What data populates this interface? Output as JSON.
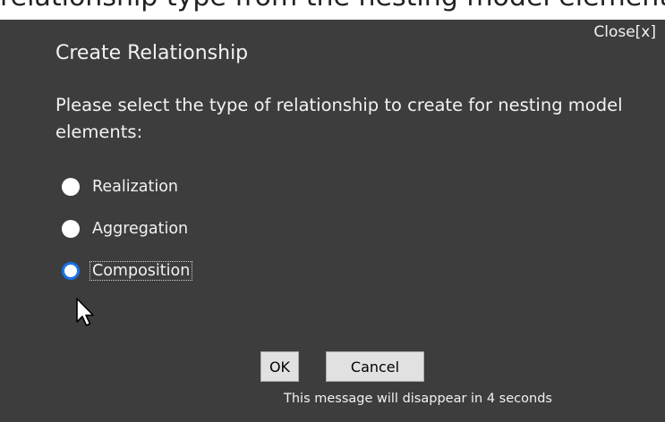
{
  "dialog": {
    "close_label": "Close[x]",
    "title": "Create Relationship",
    "message": "Please select the type of relationship to create for nesting model elements:",
    "options": [
      {
        "label": "Realization",
        "selected": false
      },
      {
        "label": "Aggregation",
        "selected": false
      },
      {
        "label": "Composition",
        "selected": true
      }
    ],
    "ok_label": "OK",
    "cancel_label": "Cancel",
    "countdown_text": "This message will disappear in 4 seconds"
  },
  "colors": {
    "dialog_background": "#3d3d3d",
    "text": "#f2f2f2",
    "radio_selected_accent": "#1a73e8",
    "button_face": "#e1e1e1"
  }
}
